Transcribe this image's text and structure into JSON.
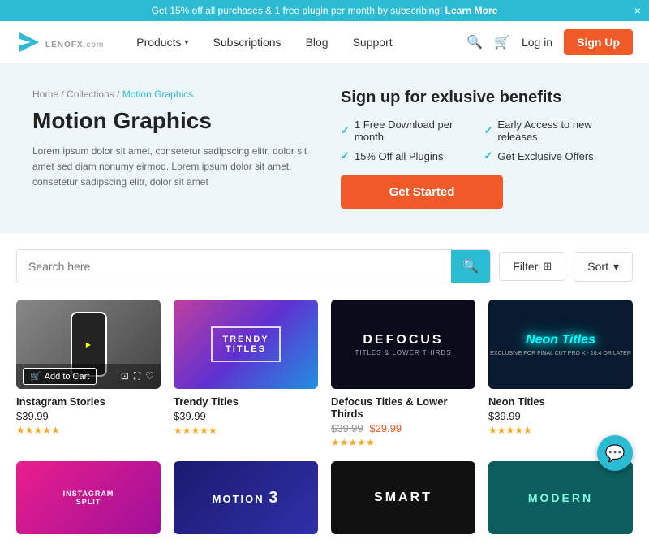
{
  "banner": {
    "text": "Get 15% off all purchases & 1 free plugin per month by subscribing!",
    "link_text": "Learn More",
    "close_label": "×"
  },
  "header": {
    "logo_text": "LENOFX",
    "logo_sub": ".com",
    "nav": [
      {
        "label": "Products",
        "has_dropdown": true
      },
      {
        "label": "Subscriptions"
      },
      {
        "label": "Blog"
      },
      {
        "label": "Support"
      }
    ],
    "login_label": "Log in",
    "signup_label": "Sign Up"
  },
  "hero": {
    "breadcrumb": [
      {
        "label": "Home",
        "href": "#"
      },
      {
        "label": "Collections",
        "href": "#"
      },
      {
        "label": "Motion Graphics",
        "current": true
      }
    ],
    "title": "Motion Graphics",
    "description": "Lorem ipsum dolor sit amet, consetetur sadipscing elitr, dolor sit amet sed diam nonumy eirmod. Lorem ipsum dolor sit amet, consetetur sadipscing elitr, dolor sit amet",
    "signup_title": "Sign up for exlusive benefits",
    "benefits_left": [
      "1 Free Download per month",
      "15% Off all Plugins"
    ],
    "benefits_right": [
      "Early Access to new releases",
      "Get Exclusive Offers"
    ],
    "cta_label": "Get Started"
  },
  "search": {
    "placeholder": "Search here",
    "filter_label": "Filter",
    "sort_label": "Sort"
  },
  "products": [
    {
      "id": 1,
      "name": "Instagram Stories",
      "price": "$39.99",
      "original_price": null,
      "sale_price": null,
      "stars": 5,
      "bg": "#555",
      "thumb_text": "",
      "thumb_style": "instagram"
    },
    {
      "id": 2,
      "name": "Trendy Titles",
      "price": "$39.99",
      "original_price": null,
      "sale_price": null,
      "stars": 5,
      "bg": "#c040a0",
      "thumb_text": "TRENDY TITLES",
      "thumb_style": "trendy"
    },
    {
      "id": 3,
      "name": "Defocus Titles & Lower Thirds",
      "price": null,
      "original_price": "$39.99",
      "sale_price": "$29.99",
      "stars": 5,
      "bg": "#1a1a2e",
      "thumb_text": "DEFOCUS",
      "thumb_style": "defocus"
    },
    {
      "id": 4,
      "name": "Neon Titles",
      "price": "$39.99",
      "original_price": null,
      "sale_price": null,
      "stars": 5,
      "bg": "#0d2b3e",
      "thumb_text": "Neon Titles",
      "thumb_style": "neon"
    }
  ],
  "products_row2": [
    {
      "id": 5,
      "bg": "#e91e8c",
      "thumb_text": "INSTAGRAM SPLIT",
      "thumb_style": "split"
    },
    {
      "id": 6,
      "bg": "#1a1a6e",
      "thumb_text": "MOTION 3",
      "thumb_style": "motion3"
    },
    {
      "id": 7,
      "bg": "#111",
      "thumb_text": "SMART",
      "thumb_style": "smart"
    },
    {
      "id": 8,
      "bg": "#0d5e5e",
      "thumb_text": "MODERN",
      "thumb_style": "modern"
    }
  ],
  "add_to_cart_label": "Add to Cart"
}
